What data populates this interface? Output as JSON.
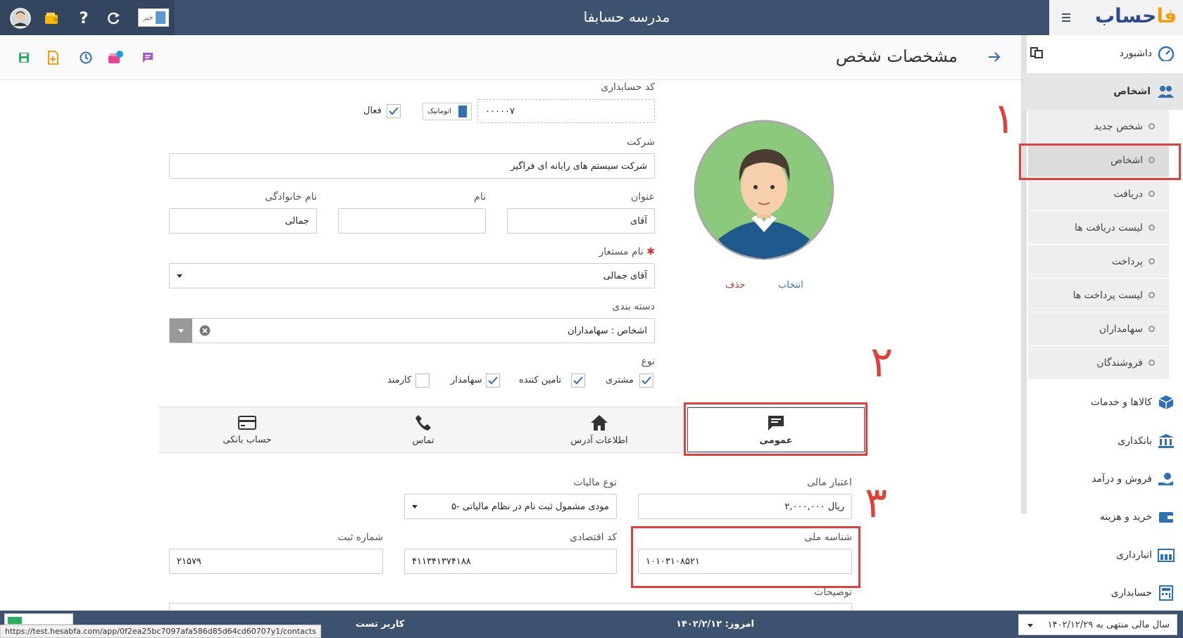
{
  "topbar": {
    "title": "مدرسه حسابفا",
    "news_label": "خبر",
    "logo_main": "حساب",
    "logo_accent": "فا"
  },
  "header": {
    "page_title": "مشخصات شخص"
  },
  "sidebar": {
    "dashboard": "داشبورد",
    "persons": "اشخاص",
    "sub": [
      "شخص جدید",
      "اشخاص",
      "دریافت",
      "لیست دریافت ها",
      "پرداخت",
      "لیست پرداخت ها",
      "سهامداران",
      "فروشندگان"
    ],
    "sections": [
      "کالاها و خدمات",
      "بانکداری",
      "فروش و درآمد",
      "خرید و هزینه",
      "انبارداری",
      "حسابداری"
    ]
  },
  "form": {
    "accounting_code_label": "کد حسابداری",
    "accounting_code_value": "۰۰۰۰۰۷",
    "auto_label": "اتوماتیک",
    "active_label": "فعال",
    "company_label": "شرکت",
    "company_value": "شرکت سیستم های رایانه ای فراگیر",
    "title_label": "عنوان",
    "title_value": "آقای",
    "name_label": "نام",
    "name_value": "",
    "lastname_label": "نام خانوادگی",
    "lastname_value": "جمالی",
    "alias_label": "نام مستعار",
    "alias_value": "آقای جمالی",
    "category_label": "دسته بندی",
    "category_value": "اشخاص : سهامداران",
    "type_label": "نوع",
    "types": [
      "مشتری",
      "تامین کننده",
      "سهامدار",
      "کارمند"
    ],
    "photo_select": "انتخاب",
    "photo_delete": "حذف"
  },
  "tabs": [
    "عمومی",
    "اطلاعات آدرس",
    "تماس",
    "حساب بانکی"
  ],
  "general": {
    "credit_label": "اعتبار مالی",
    "credit_value": "۲,۰۰۰,۰۰۰ ریال",
    "tax_type_label": "نوع مالیات",
    "tax_type_value": "۵- مودی مشمول ثبت نام در نظام مالیاتی",
    "national_id_label": "شناسه ملی",
    "national_id_value": "۱۰۱۰۳۱۰۸۵۲۱",
    "economic_code_label": "کد اقتصادی",
    "economic_code_value": "۴۱۱۳۴۱۳۷۴۱۸۸",
    "reg_no_label": "شماره ثبت",
    "reg_no_value": "۲۱۵۷۹",
    "description_label": "توضیحات"
  },
  "annotations": [
    "۱",
    "۲",
    "۳"
  ],
  "status": {
    "url": "https://test.hesabfa.com/app/0f2ea25bc7097afa586d85d64cd60707y1/contacts",
    "user": "کاربر تست",
    "today": "امروز: ۱۴۰۲/۲/۱۲",
    "fiscal_year": "سال مالی منتهی به ۱۴۰۲/۱۲/۲۹"
  },
  "colors": {
    "topbar": "#3d526e",
    "accent_red": "#e0403a",
    "logo_orange": "#f39c12"
  }
}
